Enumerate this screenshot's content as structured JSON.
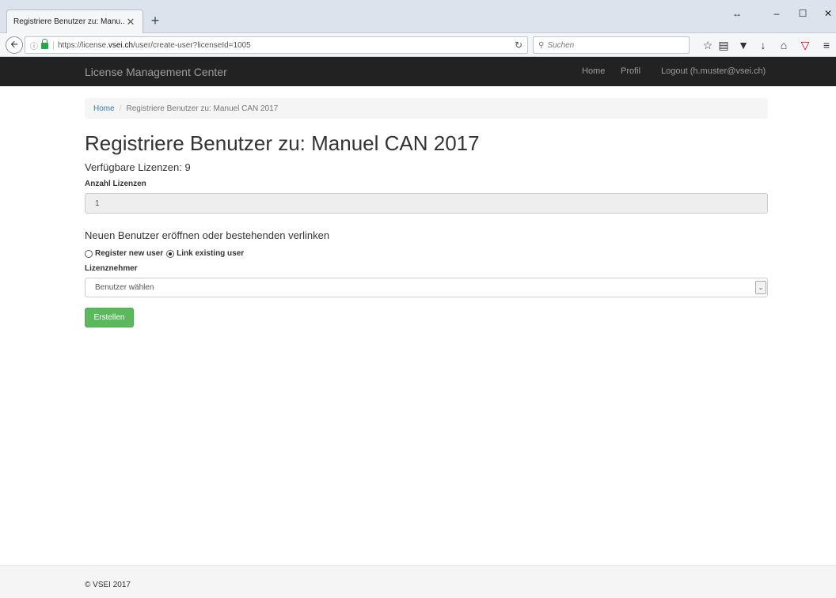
{
  "browser": {
    "tab_title": "Registriere Benutzer zu: Manu...",
    "tab_close": "✕",
    "new_tab": "+",
    "url_prefix": "https://license.",
    "url_domain": "vsei.ch",
    "url_path": "/user/create-user?licenseId=1005",
    "search_placeholder": "Suchen",
    "window_controls": {
      "resize": "↔",
      "minimize": "–",
      "maximize": "☐",
      "close": "✕"
    }
  },
  "navbar": {
    "brand": "License Management Center",
    "links": [
      "Home",
      "Profil",
      "Logout (h.muster@vsei.ch)"
    ]
  },
  "breadcrumb": {
    "home": "Home",
    "separator": "/",
    "current": "Registriere Benutzer zu: Manuel CAN 2017"
  },
  "page": {
    "title": "Registriere Benutzer zu: Manuel CAN 2017",
    "available_licenses": "Verfügbare Lizenzen: 9",
    "quantity_label": "Anzahl Lizenzen",
    "quantity_value": "1",
    "section_heading": "Neuen Benutzer eröffnen oder bestehenden verlinken",
    "radio_register": "Register new user",
    "radio_link": "Link existing user",
    "licensee_label": "Lizenznehmer",
    "licensee_select": "Benutzer wählen",
    "submit_label": "Erstellen"
  },
  "footer": {
    "text": "© VSEI 2017"
  }
}
